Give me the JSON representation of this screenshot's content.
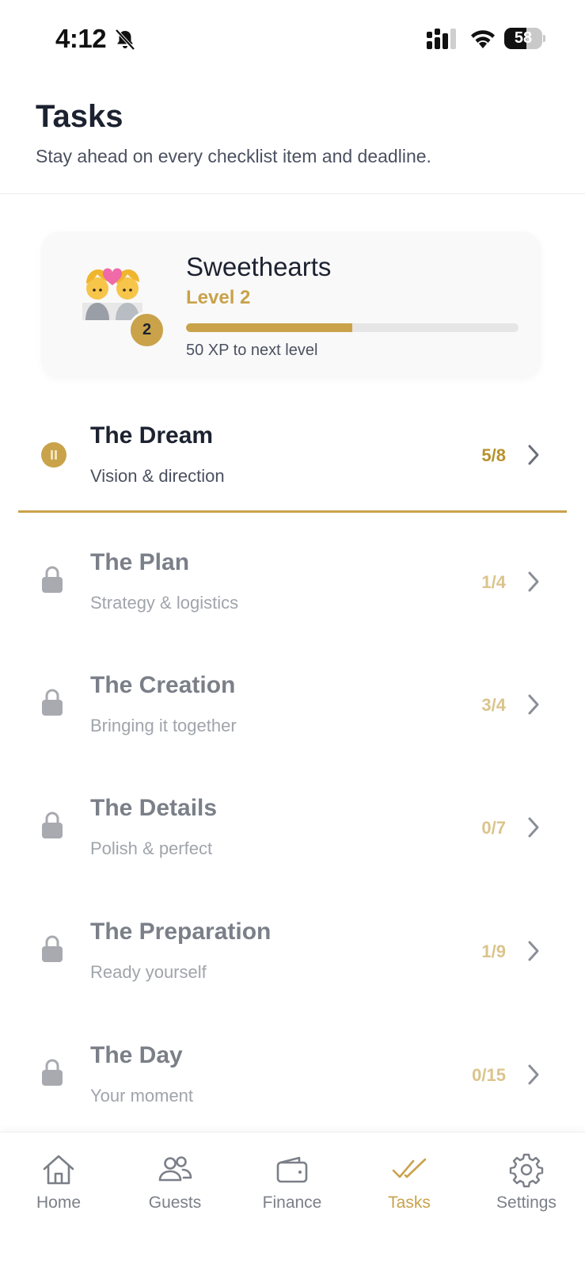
{
  "status_bar": {
    "time": "4:12",
    "battery": "58",
    "battery_level": 0.58
  },
  "header": {
    "title": "Tasks",
    "subtitle": "Stay ahead on every checklist item and deadline."
  },
  "profile": {
    "name": "Sweethearts",
    "level_label": "Level 2",
    "level_badge": "2",
    "xp_progress": 0.5,
    "xp_text": "50 XP to next level",
    "avatar": "couple-with-heart-emoji"
  },
  "stages": [
    {
      "title": "The Dream",
      "subtitle": "Vision & direction",
      "count": "5/8",
      "state": "active",
      "icon": "pause-icon"
    },
    {
      "title": "The Plan",
      "subtitle": "Strategy & logistics",
      "count": "1/4",
      "state": "locked",
      "icon": "lock-icon"
    },
    {
      "title": "The Creation",
      "subtitle": "Bringing it together",
      "count": "3/4",
      "state": "locked",
      "icon": "lock-icon"
    },
    {
      "title": "The Details",
      "subtitle": "Polish & perfect",
      "count": "0/7",
      "state": "locked",
      "icon": "lock-icon"
    },
    {
      "title": "The Preparation",
      "subtitle": "Ready yourself",
      "count": "1/9",
      "state": "locked",
      "icon": "lock-icon"
    },
    {
      "title": "The Day",
      "subtitle": "Your moment",
      "count": "0/15",
      "state": "locked",
      "icon": "lock-icon"
    }
  ],
  "tab_bar": {
    "tabs": [
      {
        "label": "Home",
        "icon": "home-icon"
      },
      {
        "label": "Guests",
        "icon": "guests-icon"
      },
      {
        "label": "Finance",
        "icon": "wallet-icon"
      },
      {
        "label": "Tasks",
        "icon": "double-check-icon",
        "active": true
      },
      {
        "label": "Settings",
        "icon": "gear-icon"
      }
    ]
  },
  "colors": {
    "accent": "#c9a24a",
    "text_primary": "#1c2230",
    "text_secondary": "#4b5160",
    "locked_icon": "#a8aab0"
  }
}
